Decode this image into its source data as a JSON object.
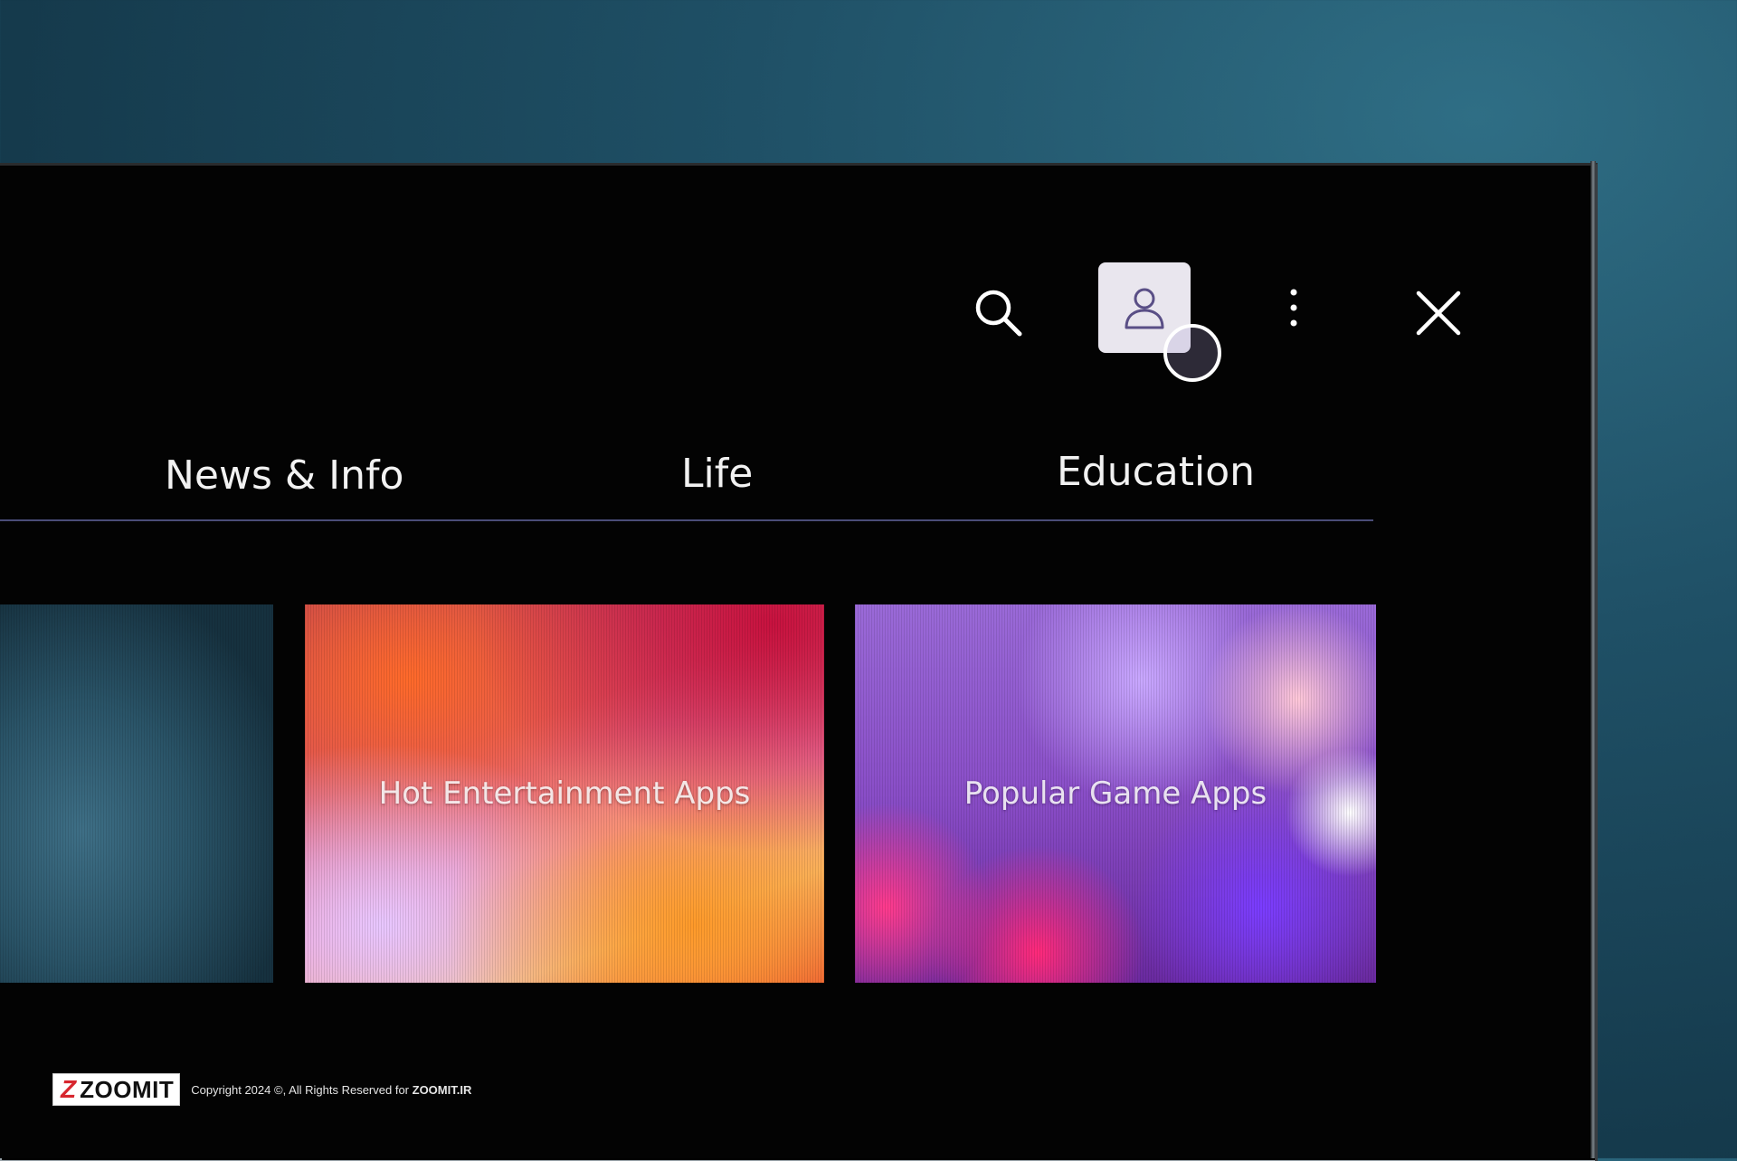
{
  "toolbar": {
    "search_icon": "search-icon",
    "account_icon": "user-icon",
    "more_icon": "more-vertical-icon",
    "close_icon": "close-icon"
  },
  "tabs": [
    {
      "label": "News & Info"
    },
    {
      "label": "Life"
    },
    {
      "label": "Education"
    }
  ],
  "cards": [
    {
      "label": ""
    },
    {
      "label": "Hot Entertainment Apps"
    },
    {
      "label": "Popular Game Apps"
    }
  ],
  "watermark": {
    "logo_mark": "Z",
    "logo_text": "ZOOMIT",
    "copyright_prefix": "Copyright 2024 ©, All Rights Reserved for ",
    "copyright_site": "ZOOMIT.IR"
  },
  "colors": {
    "accent_divider": "#4a4d78",
    "account_button_bg": "#e9e6ee",
    "brand_red": "#d7262e"
  }
}
